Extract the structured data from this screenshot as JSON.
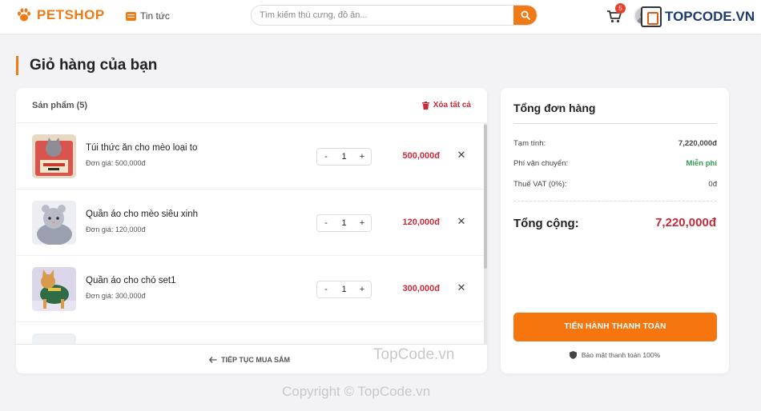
{
  "header": {
    "logo_text": "PETSHOP",
    "nav_news": "Tin tức",
    "search_placeholder": "Tìm kiếm thú cưng, đồ ăn...",
    "cart_count": "5",
    "watermark": "TOPCODE.VN"
  },
  "page": {
    "title": "Giỏ hàng của bạn"
  },
  "cart": {
    "count_label": "Sản phẩm (5)",
    "clear_all": "Xóa tất cả",
    "items": [
      {
        "name": "Túi thức ăn cho mèo loại to",
        "unit_price": "Đơn giá: 500,000đ",
        "qty": "1",
        "total": "500,000đ"
      },
      {
        "name": "Quần áo cho mèo siêu xinh",
        "unit_price": "Đơn giá: 120,000đ",
        "qty": "1",
        "total": "120,000đ"
      },
      {
        "name": "Quần áo cho chó set1",
        "unit_price": "Đơn giá: 300,000đ",
        "qty": "1",
        "total": "300,000đ"
      }
    ],
    "continue_label": "TIẾP TỤC MUA SẮM"
  },
  "summary": {
    "title": "Tổng đơn hàng",
    "subtotal_label": "Tạm tính:",
    "subtotal_value": "7,220,000đ",
    "shipping_label": "Phí vận chuyển:",
    "shipping_value": "Miễn phí",
    "vat_label": "Thuế VAT (0%):",
    "vat_value": "0đ",
    "total_label": "Tổng cộng:",
    "total_value": "7,220,000đ",
    "checkout_label": "TIẾN HÀNH THANH TOÁN",
    "secure_label": "Bảo mật thanh toán 100%"
  },
  "watermarks": {
    "center": "TopCode.vn",
    "footer": "Copyright © TopCode.vn"
  },
  "colors": {
    "brand": "#f07a16",
    "price": "#c62b3a",
    "free": "#2f9e4f"
  }
}
